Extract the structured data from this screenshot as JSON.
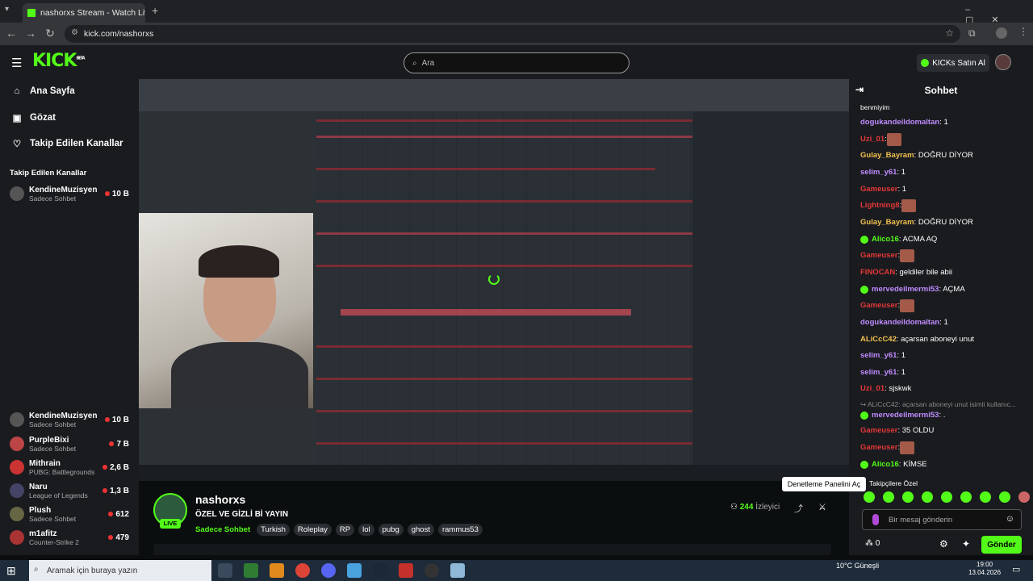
{
  "browser": {
    "tab_title": "nashorxs Stream - Watch Live o",
    "url": "kick.com/nashorxs"
  },
  "header": {
    "logo": "KICK",
    "logo_beta": "BETA",
    "search_placeholder": "Ara",
    "kicks_button": "KICKs Satın Al"
  },
  "sidebar": {
    "nav": [
      {
        "label": "Ana Sayfa"
      },
      {
        "label": "Gözat"
      },
      {
        "label": "Takip Edilen Kanallar"
      }
    ],
    "section_title": "Takip Edilen Kanallar",
    "channels": [
      {
        "name": "KendineMuzisyen",
        "sub": "Sadece Sohbet",
        "count": "10 B"
      },
      {
        "name": "KendineMuzisyen",
        "sub": "Sadece Sohbet",
        "count": "10 B"
      },
      {
        "name": "PurpleBixi",
        "sub": "Sadece Sohbet",
        "count": "7 B"
      },
      {
        "name": "Mithrain",
        "sub": "PUBG: Battlegrounds",
        "count": "2,6 B"
      },
      {
        "name": "Naru",
        "sub": "League of Legends",
        "count": "1,3 B"
      },
      {
        "name": "Plush",
        "sub": "Sadece Sohbet",
        "count": "612"
      },
      {
        "name": "m1afitz",
        "sub": "Counter-Strike 2",
        "count": "479"
      }
    ]
  },
  "stream": {
    "streamer": "nashorxs",
    "live_label": "LIVE",
    "title": "ÖZEL VE GİZLİ Bİ YAYIN",
    "category": "Sadece Sohbet",
    "tags": [
      "Turkish",
      "Roleplay",
      "RP",
      "lol",
      "pubg",
      "ghost",
      "rammus53"
    ],
    "viewers_count": "244",
    "viewers_label": "İzleyici"
  },
  "chat": {
    "title": "Sohbet",
    "messages": [
      {
        "user": "",
        "text": "benmiyim",
        "color": "#ffffff",
        "badge": false,
        "emote": false
      },
      {
        "user": "dogukandeildomaltan",
        "text": ": 1",
        "color": "#c08cff",
        "badge": false,
        "emote": false
      },
      {
        "user": "Uzi_01",
        "text": ": ",
        "color": "#e53838",
        "badge": false,
        "emote": true
      },
      {
        "user": "Gulay_Bayram",
        "text": ": DOĞRU DİYOR",
        "color": "#f2c14e",
        "badge": false,
        "emote": false
      },
      {
        "user": "selim_y61",
        "text": ": 1",
        "color": "#c08cff",
        "badge": false,
        "emote": false
      },
      {
        "user": "Gameuser",
        "text": ": 1",
        "color": "#e53838",
        "badge": false,
        "emote": false
      },
      {
        "user": "Lightning8",
        "text": ": ",
        "color": "#e53838",
        "badge": false,
        "emote": true
      },
      {
        "user": "Gulay_Bayram",
        "text": ": DOĞRU DİYOR",
        "color": "#f2c14e",
        "badge": false,
        "emote": false
      },
      {
        "user": "Alico16",
        "text": ": ACMA AQ",
        "color": "#53fc18",
        "badge": true,
        "emote": false
      },
      {
        "user": "Gameuser",
        "text": ": ",
        "color": "#e53838",
        "badge": false,
        "emote": true
      },
      {
        "user": "FINOCAN",
        "text": ": geldiler bile abii",
        "color": "#e53838",
        "badge": false,
        "emote": false
      },
      {
        "user": "mervedeilmermi53",
        "text": ": AÇMA",
        "color": "#c08cff",
        "badge": true,
        "emote": false
      },
      {
        "user": "Gameuser",
        "text": ": ",
        "color": "#e53838",
        "badge": false,
        "emote": true
      },
      {
        "user": "dogukandeildomaltan",
        "text": ": 1",
        "color": "#c08cff",
        "badge": false,
        "emote": false
      },
      {
        "user": "ALiCcC42",
        "text": ": açarsan aboneyi unut",
        "color": "#f2c14e",
        "badge": false,
        "emote": false
      },
      {
        "user": "selim_y61",
        "text": ": 1",
        "color": "#c08cff",
        "badge": false,
        "emote": false
      },
      {
        "user": "selim_y61",
        "text": ": 1",
        "color": "#c08cff",
        "badge": false,
        "emote": false
      },
      {
        "user": "Uzi_01",
        "text": ": sjskwk",
        "color": "#e53838",
        "badge": false,
        "emote": false
      },
      {
        "user": "",
        "text": "↪ ALiCcC42: açarsan aboneyi unut isimli kullanıc...",
        "color": "#888888",
        "badge": false,
        "emote": false
      },
      {
        "user": "mervedeilmermi53",
        "text": ": .",
        "color": "#c08cff",
        "badge": true,
        "emote": false
      },
      {
        "user": "Gameuser",
        "text": ": 35 OLDU",
        "color": "#e53838",
        "badge": false,
        "emote": false
      },
      {
        "user": "Gameuser",
        "text": ": ",
        "color": "#e53838",
        "badge": false,
        "emote": true
      },
      {
        "user": "Alico16",
        "text": ": KİMSE",
        "color": "#53fc18",
        "badge": true,
        "emote": false
      }
    ],
    "tooltip": "Denetleme Panelini Aç",
    "followers_only": "Takipçilere Özel",
    "input_placeholder": "Bir mesaj gönderin",
    "send_label": "Gönder",
    "points": "0"
  },
  "taskbar": {
    "search_placeholder": "Aramak için buraya yazın",
    "weather": "10°C  Güneşli",
    "time": "19:00",
    "date": "13.04.2026"
  },
  "colors": {
    "accent": "#53fc18",
    "panel": "#191b1f",
    "bg": "#0b0e0f"
  }
}
